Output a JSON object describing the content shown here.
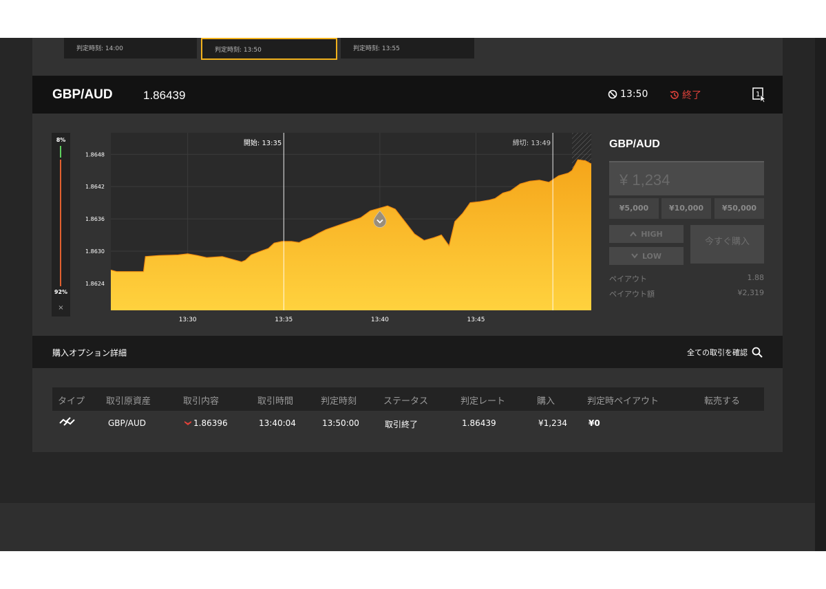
{
  "option_tiles": [
    {
      "label": "判定時刻: 14:00",
      "selected": false
    },
    {
      "label": "判定時刻: 13:50",
      "selected": true
    },
    {
      "label": "判定時刻: 13:55",
      "selected": false
    }
  ],
  "header": {
    "pair": "GBP/AUD",
    "rate": "1.86439",
    "expiry_time": "13:50",
    "status": "終了"
  },
  "gauge": {
    "high_percent_label": "8%",
    "low_percent_label": "92%",
    "high_percent": 8,
    "low_percent": 92,
    "close_symbol": "×"
  },
  "chart_data": {
    "type": "area",
    "x_ticks": [
      "13:30",
      "13:35",
      "13:40",
      "13:45"
    ],
    "y_ticks": [
      "1.8648",
      "1.8642",
      "1.8636",
      "1.8630",
      "1.8624"
    ],
    "ylim": [
      1.8619,
      1.8652
    ],
    "xlim_minutes": [
      0,
      25
    ],
    "start_label": "開始: 13:35",
    "cutoff_label": "締切: 13:49",
    "entry_marker_minute": 14.0,
    "series": [
      {
        "points": [
          [
            0,
            1.86265
          ],
          [
            0.3,
            1.86262
          ],
          [
            1.0,
            1.86262
          ],
          [
            1.7,
            1.86262
          ],
          [
            1.8,
            1.8629
          ],
          [
            2.5,
            1.86292
          ],
          [
            3.5,
            1.86293
          ],
          [
            4.0,
            1.86295
          ],
          [
            4.5,
            1.86292
          ],
          [
            5.0,
            1.86288
          ],
          [
            5.8,
            1.8629
          ],
          [
            6.3,
            1.86285
          ],
          [
            6.8,
            1.8628
          ],
          [
            7.0,
            1.86283
          ],
          [
            7.3,
            1.86293
          ],
          [
            7.8,
            1.863
          ],
          [
            8.2,
            1.86305
          ],
          [
            8.5,
            1.86315
          ],
          [
            8.9,
            1.86318
          ],
          [
            9.4,
            1.86318
          ],
          [
            9.8,
            1.86316
          ],
          [
            10.0,
            1.8632
          ],
          [
            10.4,
            1.86325
          ],
          [
            10.8,
            1.86333
          ],
          [
            11.2,
            1.8634
          ],
          [
            11.6,
            1.86345
          ],
          [
            12.0,
            1.8635
          ],
          [
            12.5,
            1.86356
          ],
          [
            13.0,
            1.86362
          ],
          [
            13.5,
            1.86375
          ],
          [
            14.0,
            1.8638
          ],
          [
            14.4,
            1.86384
          ],
          [
            14.8,
            1.86378
          ],
          [
            15.3,
            1.86355
          ],
          [
            15.8,
            1.86332
          ],
          [
            16.3,
            1.8632
          ],
          [
            16.8,
            1.86325
          ],
          [
            17.2,
            1.8633
          ],
          [
            17.6,
            1.8631
          ],
          [
            17.9,
            1.86355
          ],
          [
            18.3,
            1.8637
          ],
          [
            18.7,
            1.8639
          ],
          [
            19.2,
            1.86392
          ],
          [
            19.7,
            1.86395
          ],
          [
            20.0,
            1.86398
          ],
          [
            20.4,
            1.86408
          ],
          [
            20.8,
            1.86412
          ],
          [
            21.3,
            1.86425
          ],
          [
            21.8,
            1.8643
          ],
          [
            22.3,
            1.86432
          ],
          [
            22.8,
            1.86428
          ],
          [
            23.3,
            1.8644
          ],
          [
            23.8,
            1.86445
          ],
          [
            24.0,
            1.8645
          ],
          [
            24.3,
            1.8647
          ],
          [
            24.7,
            1.86468
          ],
          [
            25.0,
            1.86462
          ]
        ]
      }
    ]
  },
  "trade_panel": {
    "pair": "GBP/AUD",
    "amount": "¥ 1,234",
    "quick_amounts": [
      "¥5,000",
      "¥10,000",
      "¥50,000"
    ],
    "high_label": "HIGH",
    "low_label": "LOW",
    "buy_now": "今すぐ購入",
    "payout_label": "ペイアウト",
    "payout_value": "1.88",
    "payout_amount_label": "ペイアウト額",
    "payout_amount_value": "¥2,319"
  },
  "details": {
    "title": "購入オプション詳細",
    "view_all": "全ての取引を確認"
  },
  "table": {
    "headers": [
      "タイプ",
      "取引原資産",
      "取引内容",
      "取引時間",
      "判定時刻",
      "ステータス",
      "判定レート",
      "購入",
      "判定時ペイアウト",
      "転売する"
    ],
    "row": {
      "asset": "GBP/AUD",
      "content": "1.86396",
      "trade_time": "13:40:04",
      "expiry": "13:50:00",
      "status": "取引終了",
      "expiry_rate": "1.86439",
      "purchase": "¥1,234",
      "payout": "¥0"
    }
  },
  "colors": {
    "accent": "#f2b21c",
    "area_top": "#f5a51a",
    "area_bottom": "#ffd23e",
    "danger": "#e0423a"
  }
}
